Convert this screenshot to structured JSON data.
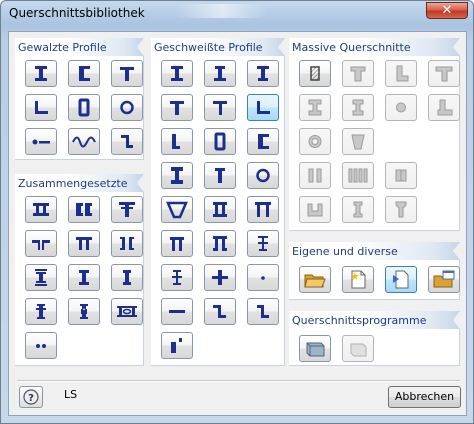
{
  "window": {
    "title": "Querschnittsbibliothek",
    "close_symbol": "✕"
  },
  "panels": {
    "gewalzte": {
      "title": "Gewalzte Profile"
    },
    "geschweisste": {
      "title": "Geschweißte Profile"
    },
    "massive": {
      "title": "Massive Querschnitte"
    },
    "zusammengesetzte": {
      "title": "Zusammengesetzte"
    },
    "eigene": {
      "title": "Eigene und diverse"
    },
    "programme": {
      "title": "Querschnittsprogramme"
    }
  },
  "footer": {
    "status_text": "LS",
    "cancel_label": "Abbrechen",
    "help_icon": "help-icon"
  },
  "colors": {
    "profile_icon": "#1c2f8c",
    "solid_disabled": "#9a9a9a",
    "panel_header_text": "#1f3d7a",
    "selected_button": "#bee6fd",
    "folder": "#e8b94a"
  }
}
